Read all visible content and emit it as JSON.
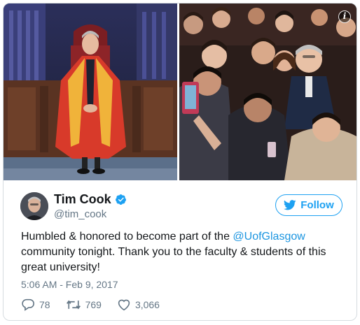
{
  "tweet": {
    "author": {
      "display_name": "Tim Cook",
      "handle": "@tim_cook",
      "verified": true
    },
    "follow_label": "Follow",
    "text_before": "Humbled & honored to become part of the ",
    "mention": "@UofGlasgow",
    "text_after": " community tonight. Thank you to the faculty & students of this great university!",
    "timestamp": "5:06 AM - Feb 9, 2017",
    "replies": "78",
    "retweets": "769",
    "likes": "3,066"
  },
  "media": {
    "count": 2,
    "info_icon": "info-icon"
  },
  "icons": {
    "verified": "verified-badge-icon",
    "follow": "twitter-bird-icon",
    "reply": "reply-icon",
    "retweet": "retweet-icon",
    "like": "heart-icon"
  },
  "colors": {
    "accent": "#1da1f2",
    "link": "#1b95e0",
    "muted": "#657786",
    "text": "#14171a",
    "border": "#d6dce0"
  }
}
